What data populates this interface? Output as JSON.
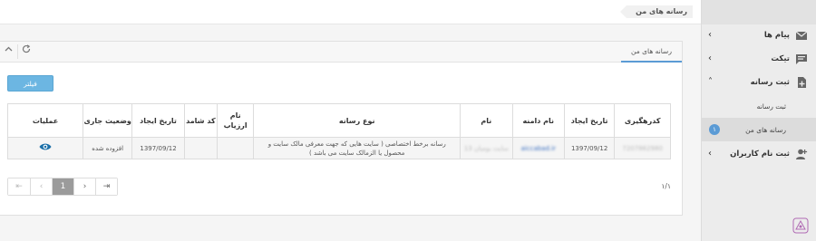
{
  "header": {
    "breadcrumb": "رسانه های من"
  },
  "sidebar": {
    "items": [
      {
        "label": "پیام ها",
        "icon": "mail-icon",
        "chevron": "‹"
      },
      {
        "label": "تیکت",
        "icon": "chat-icon",
        "chevron": "‹"
      },
      {
        "label": "ثبت رسانه",
        "icon": "add-file-icon",
        "chevron": "˄"
      },
      {
        "label": "ثبت نام کاربران",
        "icon": "add-user-icon",
        "chevron": "‹"
      }
    ],
    "subitems": [
      {
        "label": "ثبت رسانه"
      },
      {
        "label": "رسانه های من",
        "badge": "۱"
      }
    ]
  },
  "panel": {
    "tab_label": "رسانه های من",
    "filter_label": "فیلتر"
  },
  "table": {
    "headers": {
      "tracking_code": "کدرهگیری",
      "created_date": "تاریخ ایجاد",
      "domain_name": "نام دامنه",
      "name": "نام",
      "media_type": "نوع رسانه",
      "evaluator": "نام ارزیاب",
      "tracking_id": "کد شامد",
      "created_date2": "تاریخ ایجاد",
      "status": "وضعیت جاری",
      "actions": "عملیات"
    },
    "rows": [
      {
        "tracking_code": "7207862980",
        "created_date": "1397/09/12",
        "domain_name": "aiccabad.ir",
        "name": "سایت بومیان 13",
        "media_type": "رسانه برخط اختصاصی ( سایت هایی که جهت معرفی مالک سایت و محصول یا الزمالک سایت می باشد )",
        "evaluator": "",
        "tracking_id": "",
        "created_date2": "1397/09/12",
        "status": "افزوده شده",
        "action_icon": "eye-icon"
      }
    ]
  },
  "pagination": {
    "buttons": [
      "⇤",
      "‹",
      "1",
      "›",
      "⇥"
    ],
    "active_index": 2,
    "page_info": "۱/۱"
  },
  "colors": {
    "accent": "#5b9bd5",
    "filter_button": "#6cb6e2",
    "eye_icon": "#1b6fa8"
  }
}
